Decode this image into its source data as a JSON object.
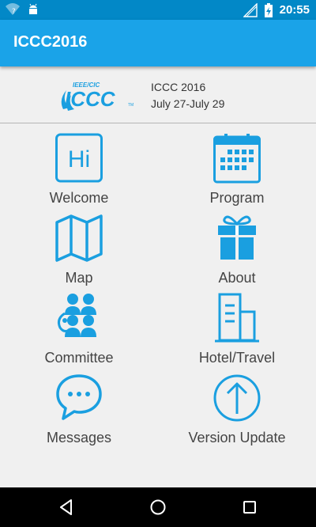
{
  "status_bar": {
    "time": "20:55",
    "icons": [
      "wifi-unknown-icon",
      "android-icon",
      "no-signal-icon",
      "battery-charging-icon"
    ]
  },
  "app_bar": {
    "title": "ICCC2016"
  },
  "header": {
    "logo": {
      "icon": "iccc-logo",
      "text_small": "IEEE/CIC",
      "text_large": "ICCC",
      "tm": "TM"
    },
    "conference_name": "ICCC 2016",
    "dates": "July 27-July 29"
  },
  "menu": [
    {
      "label": "Welcome",
      "icon": "hi-icon"
    },
    {
      "label": "Program",
      "icon": "calendar-icon"
    },
    {
      "label": "Map",
      "icon": "map-icon"
    },
    {
      "label": "About",
      "icon": "gift-icon"
    },
    {
      "label": "Committee",
      "icon": "people-icon"
    },
    {
      "label": "Hotel/Travel",
      "icon": "building-icon"
    },
    {
      "label": "Messages",
      "icon": "chat-icon"
    },
    {
      "label": "Version Update",
      "icon": "upload-arrow-icon"
    }
  ],
  "nav_bar": {
    "buttons": [
      "back-icon",
      "home-icon",
      "recents-icon"
    ]
  },
  "colors": {
    "accent": "#1aa3e8",
    "status_bar": "#0288c7",
    "icon": "#1a9fe0"
  }
}
